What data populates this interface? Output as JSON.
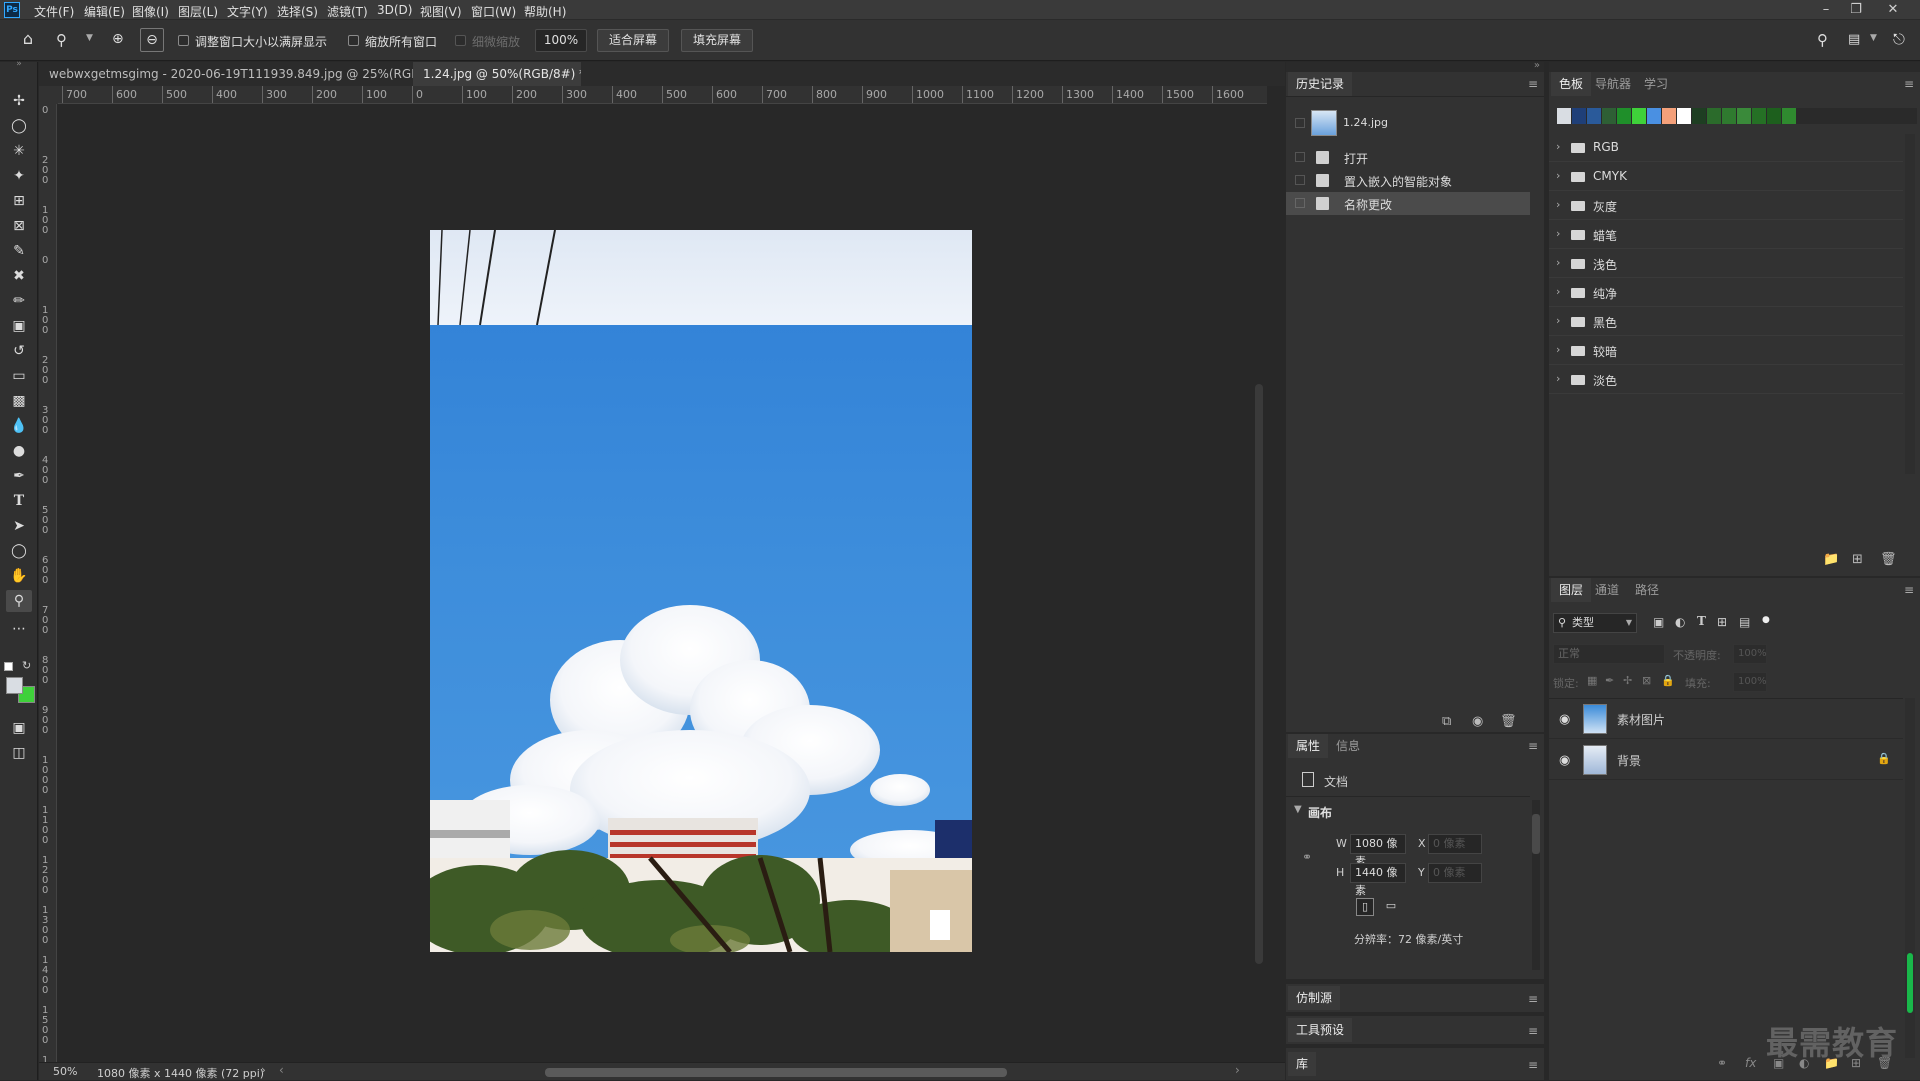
{
  "app": {
    "logo": "Ps"
  },
  "menubar": {
    "items": [
      "文件(F)",
      "编辑(E)",
      "图像(I)",
      "图层(L)",
      "文字(Y)",
      "选择(S)",
      "滤镜(T)",
      "3D(D)",
      "视图(V)",
      "窗口(W)",
      "帮助(H)"
    ],
    "window_controls": [
      "minimize-icon",
      "restore-icon",
      "close-icon"
    ]
  },
  "options": {
    "resize_windows_label": "调整窗口大小以满屏显示",
    "zoom_all_label": "缩放所有窗口",
    "scrubby_label": "细微缩放",
    "zoom_value": "100%",
    "fit_screen": "适合屏幕",
    "fill_screen": "填充屏幕"
  },
  "tabs": [
    {
      "label": "webwxgetmsgimg - 2020-06-19T111939.849.jpg @ 25%(RGB/8) *",
      "close": "×",
      "active": false
    },
    {
      "label": "1.24.jpg @ 50%(RGB/8#) *",
      "close": "×",
      "active": true
    }
  ],
  "ruler": {
    "h_labels": [
      "700",
      "600",
      "500",
      "400",
      "300",
      "200",
      "100",
      "0",
      "100",
      "200",
      "300",
      "400",
      "500",
      "600",
      "700",
      "800",
      "900",
      "1000",
      "1100",
      "1200",
      "1300",
      "1400",
      "1500",
      "1600"
    ],
    "v_labels": [
      "0",
      "200",
      "100",
      "0",
      "100",
      "200",
      "300",
      "400",
      "500",
      "600",
      "700",
      "800",
      "900",
      "1000",
      "1100",
      "1200",
      "1300",
      "1400",
      "1500",
      "1600"
    ]
  },
  "status": {
    "zoom": "50%",
    "doc_info": "1080 像素 x 1440 像素 (72 ppi)"
  },
  "history": {
    "tab": "历史记录",
    "snapshot": "1.24.jpg",
    "items": [
      {
        "label": "打开",
        "selected": false
      },
      {
        "label": "置入嵌入的智能对象",
        "selected": false
      },
      {
        "label": "名称更改",
        "selected": true
      }
    ]
  },
  "swatches": {
    "tabs": [
      "色板",
      "导航器",
      "学习"
    ],
    "recent_colors": [
      "#d9dde3",
      "#1f3f78",
      "#2a5a9a",
      "#2e5f35",
      "#1f8f2a",
      "#3fd13a",
      "#4a90e2",
      "#f4a07a",
      "#ffffff",
      "#1e3e22",
      "#2b6b2b",
      "#2f7a2f",
      "#3a8a3a",
      "#257025",
      "#1d5f1d",
      "#2f8a2f"
    ],
    "groups": [
      "RGB",
      "CMYK",
      "灰度",
      "蜡笔",
      "浅色",
      "纯净",
      "黑色",
      "较暗",
      "淡色"
    ]
  },
  "properties": {
    "tabs": [
      "属性",
      "信息"
    ],
    "doc_label": "文档",
    "section": "画布",
    "w_label": "W",
    "w_value": "1080 像素",
    "h_label": "H",
    "h_value": "1440 像素",
    "x_label": "X",
    "x_placeholder": "0 像素",
    "y_label": "Y",
    "y_placeholder": "0 像素",
    "resolution": "分辨率：72 像素/英寸"
  },
  "collapsed_panels": [
    "仿制源",
    "工具预设",
    "库"
  ],
  "layers": {
    "tabs": [
      "图层",
      "通道",
      "路径"
    ],
    "filter": "类型",
    "blend_mode": "正常",
    "opacity_label": "不透明度:",
    "opacity_value": "100%",
    "lock_label": "锁定:",
    "fill_label": "填充:",
    "fill_value": "100%",
    "items": [
      {
        "name": "素材图片",
        "locked": false
      },
      {
        "name": "背景",
        "locked": true
      }
    ]
  },
  "watermark": "最需教育"
}
